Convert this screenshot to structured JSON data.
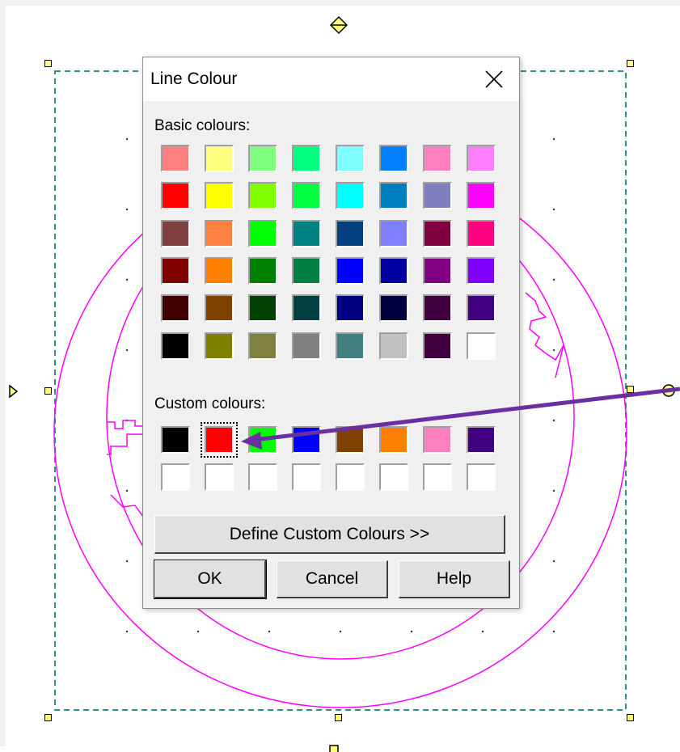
{
  "dialog": {
    "title": "Line Colour",
    "close_symbol": "×",
    "basic_label": "Basic colours:",
    "custom_label": "Custom colours:",
    "define_button": "Define Custom Colours >>",
    "ok_button": "OK",
    "cancel_button": "Cancel",
    "help_button": "Help"
  },
  "basic_colours": [
    [
      "#ff8080",
      "#ffff80",
      "#80ff80",
      "#00ff80",
      "#80ffff",
      "#0080ff",
      "#ff80c0",
      "#ff80ff"
    ],
    [
      "#ff0000",
      "#ffff00",
      "#80ff00",
      "#00ff40",
      "#00ffff",
      "#0080c0",
      "#8080c0",
      "#ff00ff"
    ],
    [
      "#804040",
      "#ff8040",
      "#00ff00",
      "#008080",
      "#004080",
      "#8080ff",
      "#800040",
      "#ff0080"
    ],
    [
      "#800000",
      "#ff8000",
      "#008000",
      "#008040",
      "#0000ff",
      "#0000a0",
      "#800080",
      "#8000ff"
    ],
    [
      "#400000",
      "#804000",
      "#004000",
      "#004040",
      "#000080",
      "#000040",
      "#400040",
      "#400080"
    ],
    [
      "#000000",
      "#808000",
      "#808040",
      "#808080",
      "#408080",
      "#c0c0c0",
      "#400040",
      "#ffffff"
    ]
  ],
  "custom_colours": [
    [
      "#000000",
      "#ff0000",
      "#00ff00",
      "#0000ff",
      "#804000",
      "#ff8000",
      "#ff80c0",
      "#400080"
    ],
    [
      "#ffffff",
      "#ffffff",
      "#ffffff",
      "#ffffff",
      "#ffffff",
      "#ffffff",
      "#ffffff",
      "#ffffff"
    ]
  ],
  "selected_custom": {
    "row": 0,
    "col": 1
  },
  "colors": {
    "drawing_stroke": "#ff00ff",
    "selection_box": "#2f8f8f",
    "handle_fill": "#ffff80",
    "annotation_arrow": "#6a2fa0",
    "dialog_bg": "#f0f0f0"
  },
  "icons": [
    "close-icon",
    "rotate-handle-icon",
    "annotation-arrow"
  ]
}
